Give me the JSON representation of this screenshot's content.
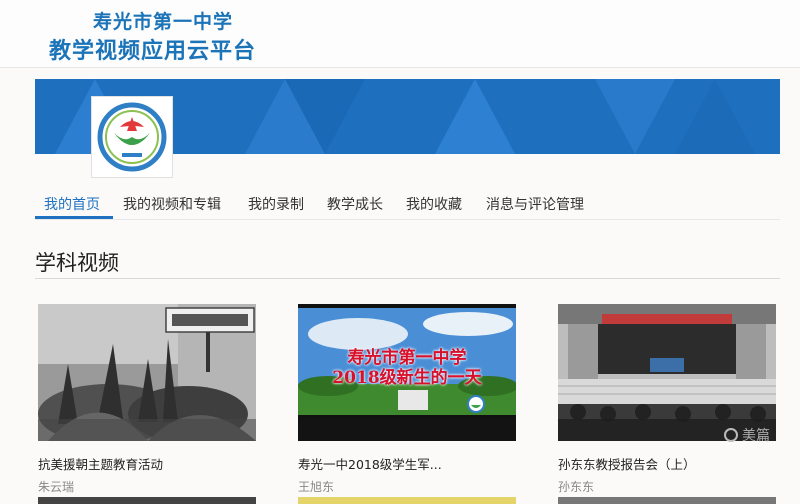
{
  "header": {
    "title_line1": "寿光市第一中学",
    "title_line2": "教学视频应用云平台"
  },
  "logo": {
    "icon": "school-emblem-icon"
  },
  "nav": {
    "items": [
      {
        "label": "我的首页",
        "active": true
      },
      {
        "label": "我的视频和专辑",
        "active": false
      },
      {
        "label": "我的录制",
        "active": false
      },
      {
        "label": "教学成长",
        "active": false
      },
      {
        "label": "我的收藏",
        "active": false
      },
      {
        "label": "消息与评论管理",
        "active": false
      }
    ]
  },
  "section": {
    "title": "学科视频"
  },
  "videos": [
    {
      "title": "抗美援朝主题教育活动",
      "author": "朱云瑞"
    },
    {
      "title": "寿光一中2018级学生军...",
      "author": "王旭东",
      "overlay_line1": "寿光市第一中学",
      "overlay_line2": "2018级新生的一天"
    },
    {
      "title": "孙东东教授报告会（上）",
      "author": "孙东东"
    }
  ],
  "watermark": "美篇",
  "colors": {
    "accent": "#1f72c2",
    "brand_title": "#1b73b8"
  }
}
